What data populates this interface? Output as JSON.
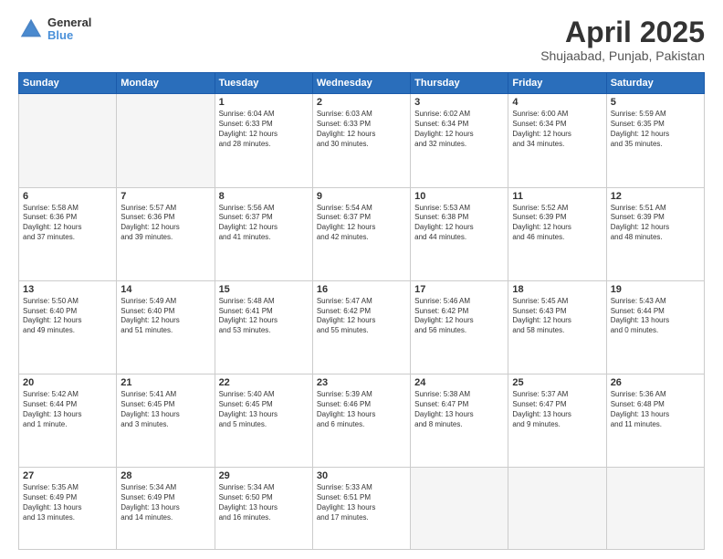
{
  "header": {
    "logo": {
      "line1": "General",
      "line2": "Blue"
    },
    "title": "April 2025",
    "location": "Shujaabad, Punjab, Pakistan"
  },
  "days_of_week": [
    "Sunday",
    "Monday",
    "Tuesday",
    "Wednesday",
    "Thursday",
    "Friday",
    "Saturday"
  ],
  "weeks": [
    [
      {
        "day": "",
        "content": ""
      },
      {
        "day": "",
        "content": ""
      },
      {
        "day": "1",
        "content": "Sunrise: 6:04 AM\nSunset: 6:33 PM\nDaylight: 12 hours\nand 28 minutes."
      },
      {
        "day": "2",
        "content": "Sunrise: 6:03 AM\nSunset: 6:33 PM\nDaylight: 12 hours\nand 30 minutes."
      },
      {
        "day": "3",
        "content": "Sunrise: 6:02 AM\nSunset: 6:34 PM\nDaylight: 12 hours\nand 32 minutes."
      },
      {
        "day": "4",
        "content": "Sunrise: 6:00 AM\nSunset: 6:34 PM\nDaylight: 12 hours\nand 34 minutes."
      },
      {
        "day": "5",
        "content": "Sunrise: 5:59 AM\nSunset: 6:35 PM\nDaylight: 12 hours\nand 35 minutes."
      }
    ],
    [
      {
        "day": "6",
        "content": "Sunrise: 5:58 AM\nSunset: 6:36 PM\nDaylight: 12 hours\nand 37 minutes."
      },
      {
        "day": "7",
        "content": "Sunrise: 5:57 AM\nSunset: 6:36 PM\nDaylight: 12 hours\nand 39 minutes."
      },
      {
        "day": "8",
        "content": "Sunrise: 5:56 AM\nSunset: 6:37 PM\nDaylight: 12 hours\nand 41 minutes."
      },
      {
        "day": "9",
        "content": "Sunrise: 5:54 AM\nSunset: 6:37 PM\nDaylight: 12 hours\nand 42 minutes."
      },
      {
        "day": "10",
        "content": "Sunrise: 5:53 AM\nSunset: 6:38 PM\nDaylight: 12 hours\nand 44 minutes."
      },
      {
        "day": "11",
        "content": "Sunrise: 5:52 AM\nSunset: 6:39 PM\nDaylight: 12 hours\nand 46 minutes."
      },
      {
        "day": "12",
        "content": "Sunrise: 5:51 AM\nSunset: 6:39 PM\nDaylight: 12 hours\nand 48 minutes."
      }
    ],
    [
      {
        "day": "13",
        "content": "Sunrise: 5:50 AM\nSunset: 6:40 PM\nDaylight: 12 hours\nand 49 minutes."
      },
      {
        "day": "14",
        "content": "Sunrise: 5:49 AM\nSunset: 6:40 PM\nDaylight: 12 hours\nand 51 minutes."
      },
      {
        "day": "15",
        "content": "Sunrise: 5:48 AM\nSunset: 6:41 PM\nDaylight: 12 hours\nand 53 minutes."
      },
      {
        "day": "16",
        "content": "Sunrise: 5:47 AM\nSunset: 6:42 PM\nDaylight: 12 hours\nand 55 minutes."
      },
      {
        "day": "17",
        "content": "Sunrise: 5:46 AM\nSunset: 6:42 PM\nDaylight: 12 hours\nand 56 minutes."
      },
      {
        "day": "18",
        "content": "Sunrise: 5:45 AM\nSunset: 6:43 PM\nDaylight: 12 hours\nand 58 minutes."
      },
      {
        "day": "19",
        "content": "Sunrise: 5:43 AM\nSunset: 6:44 PM\nDaylight: 13 hours\nand 0 minutes."
      }
    ],
    [
      {
        "day": "20",
        "content": "Sunrise: 5:42 AM\nSunset: 6:44 PM\nDaylight: 13 hours\nand 1 minute."
      },
      {
        "day": "21",
        "content": "Sunrise: 5:41 AM\nSunset: 6:45 PM\nDaylight: 13 hours\nand 3 minutes."
      },
      {
        "day": "22",
        "content": "Sunrise: 5:40 AM\nSunset: 6:45 PM\nDaylight: 13 hours\nand 5 minutes."
      },
      {
        "day": "23",
        "content": "Sunrise: 5:39 AM\nSunset: 6:46 PM\nDaylight: 13 hours\nand 6 minutes."
      },
      {
        "day": "24",
        "content": "Sunrise: 5:38 AM\nSunset: 6:47 PM\nDaylight: 13 hours\nand 8 minutes."
      },
      {
        "day": "25",
        "content": "Sunrise: 5:37 AM\nSunset: 6:47 PM\nDaylight: 13 hours\nand 9 minutes."
      },
      {
        "day": "26",
        "content": "Sunrise: 5:36 AM\nSunset: 6:48 PM\nDaylight: 13 hours\nand 11 minutes."
      }
    ],
    [
      {
        "day": "27",
        "content": "Sunrise: 5:35 AM\nSunset: 6:49 PM\nDaylight: 13 hours\nand 13 minutes."
      },
      {
        "day": "28",
        "content": "Sunrise: 5:34 AM\nSunset: 6:49 PM\nDaylight: 13 hours\nand 14 minutes."
      },
      {
        "day": "29",
        "content": "Sunrise: 5:34 AM\nSunset: 6:50 PM\nDaylight: 13 hours\nand 16 minutes."
      },
      {
        "day": "30",
        "content": "Sunrise: 5:33 AM\nSunset: 6:51 PM\nDaylight: 13 hours\nand 17 minutes."
      },
      {
        "day": "",
        "content": ""
      },
      {
        "day": "",
        "content": ""
      },
      {
        "day": "",
        "content": ""
      }
    ]
  ]
}
